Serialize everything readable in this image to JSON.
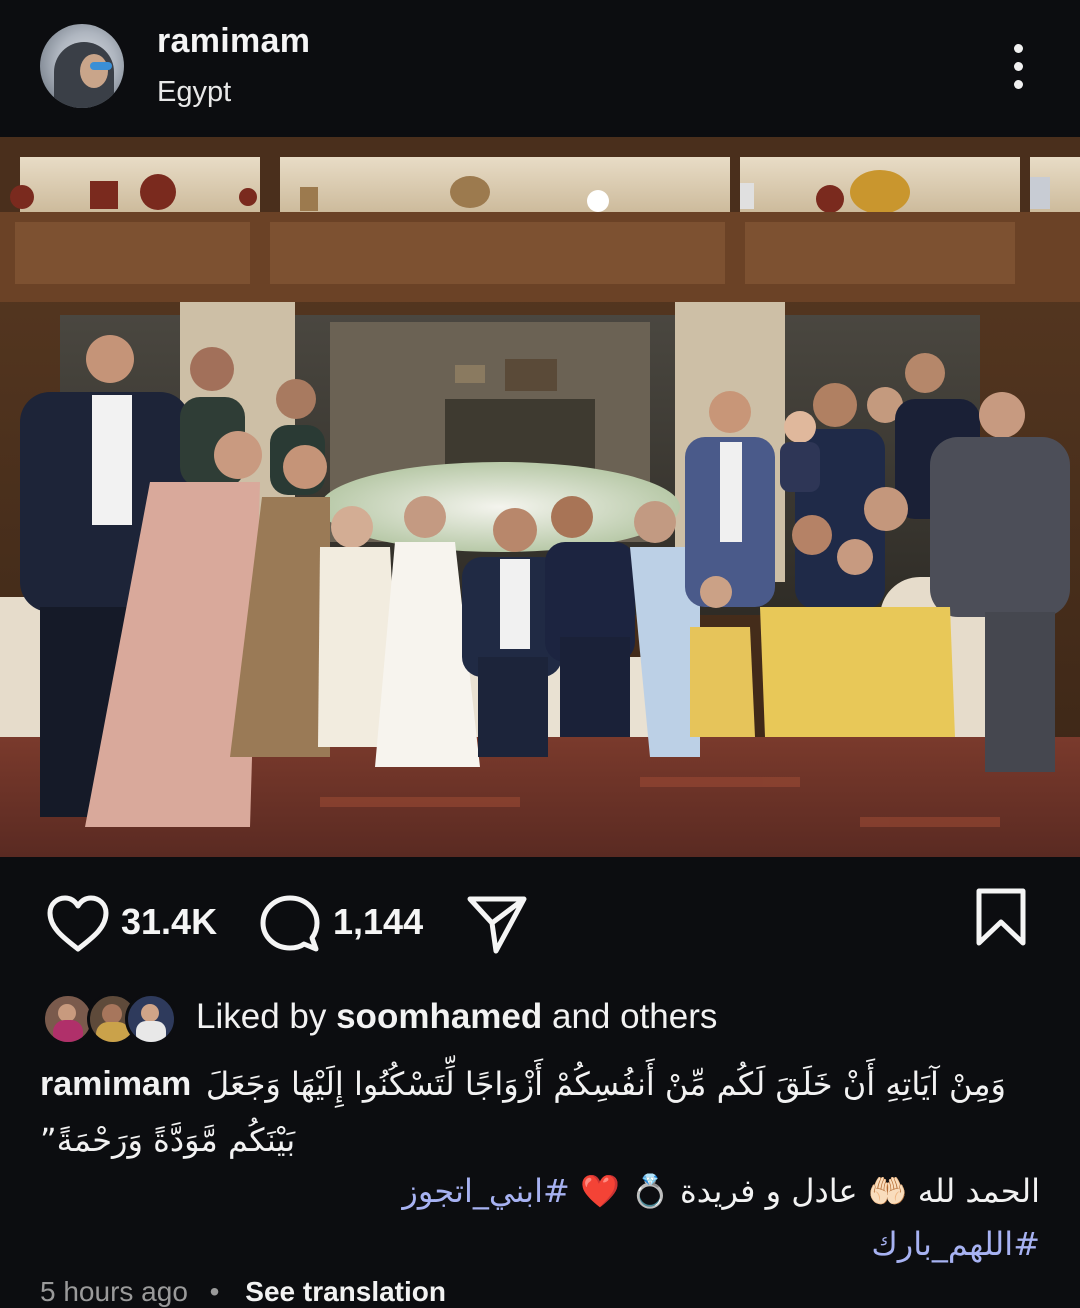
{
  "post": {
    "username": "ramimam",
    "location": "Egypt"
  },
  "actions": {
    "like_count": "31.4K",
    "comment_count": "1,144"
  },
  "likes": {
    "prefix": "Liked by ",
    "user": "soomhamed",
    "suffix": " and others"
  },
  "caption": {
    "username": "ramimam",
    "line1": "وَمِنْ آيَاتِهِ أَنْ خَلَقَ لَكُم مِّنْ أَنفُسِكُمْ أَزْوَاجًا لِّتَسْكُنُوا إِلَيْهَا وَجَعَلَ",
    "line2": "بَيْنَكُم مَّوَدَّةً وَرَحْمَةً”",
    "line3_text": "الحمد لله 🤲🏻 عادل و فريدة 💍",
    "line3_heart": "❤️",
    "hashtag1": "#ابني_اتجوز",
    "hashtag2": "#اللهم_بارك"
  },
  "footer": {
    "time": "5 hours ago",
    "separator": "•",
    "see_translation": "See translation"
  },
  "colors": {
    "background": "#0c0d10",
    "hashtag": "#a7b2f2",
    "text": "#f5f5f5"
  }
}
